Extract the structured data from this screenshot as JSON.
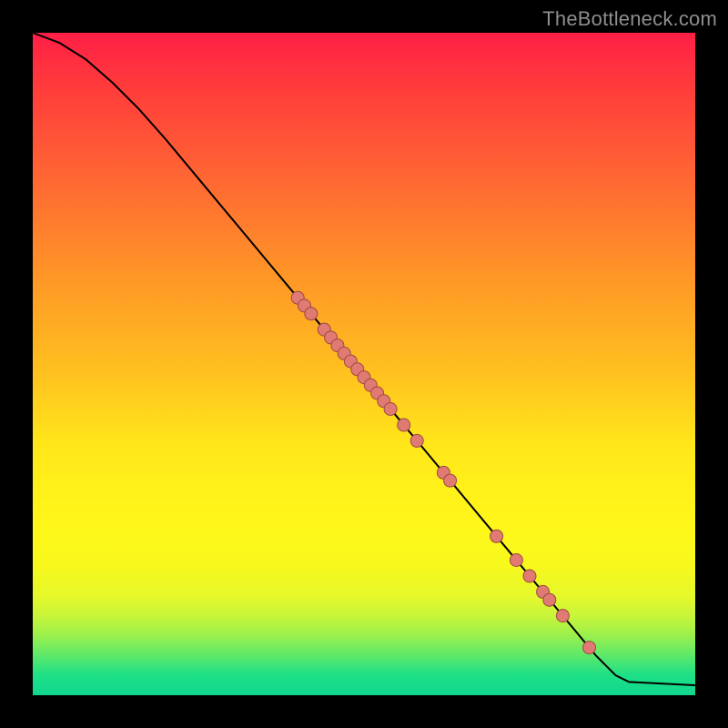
{
  "watermark": "TheBottleneck.com",
  "chart_data": {
    "type": "line",
    "title": "",
    "xlabel": "",
    "ylabel": "",
    "xlim": [
      0,
      100
    ],
    "ylim": [
      0,
      100
    ],
    "grid": false,
    "curve": [
      {
        "x": 0,
        "y": 100
      },
      {
        "x": 4,
        "y": 98.5
      },
      {
        "x": 8,
        "y": 96
      },
      {
        "x": 12,
        "y": 92.5
      },
      {
        "x": 16,
        "y": 88.5
      },
      {
        "x": 20,
        "y": 84
      },
      {
        "x": 25,
        "y": 78
      },
      {
        "x": 30,
        "y": 72
      },
      {
        "x": 35,
        "y": 66
      },
      {
        "x": 40,
        "y": 60
      },
      {
        "x": 45,
        "y": 54
      },
      {
        "x": 50,
        "y": 48
      },
      {
        "x": 55,
        "y": 42
      },
      {
        "x": 60,
        "y": 36
      },
      {
        "x": 65,
        "y": 30
      },
      {
        "x": 70,
        "y": 24
      },
      {
        "x": 75,
        "y": 18
      },
      {
        "x": 80,
        "y": 12
      },
      {
        "x": 85,
        "y": 6
      },
      {
        "x": 88,
        "y": 3
      },
      {
        "x": 90,
        "y": 2
      },
      {
        "x": 100,
        "y": 1.5
      }
    ],
    "points": [
      {
        "x": 40,
        "y": 60
      },
      {
        "x": 41,
        "y": 58.8
      },
      {
        "x": 42,
        "y": 57.6
      },
      {
        "x": 44,
        "y": 55.2
      },
      {
        "x": 45,
        "y": 54
      },
      {
        "x": 46,
        "y": 52.8
      },
      {
        "x": 47,
        "y": 51.6
      },
      {
        "x": 48,
        "y": 50.4
      },
      {
        "x": 49,
        "y": 49.2
      },
      {
        "x": 50,
        "y": 48
      },
      {
        "x": 51,
        "y": 46.8
      },
      {
        "x": 52,
        "y": 45.6
      },
      {
        "x": 53,
        "y": 44.4
      },
      {
        "x": 54,
        "y": 43.2
      },
      {
        "x": 56,
        "y": 40.8
      },
      {
        "x": 58,
        "y": 38.4
      },
      {
        "x": 62,
        "y": 33.6
      },
      {
        "x": 63,
        "y": 32.4
      },
      {
        "x": 70,
        "y": 24
      },
      {
        "x": 73,
        "y": 20.4
      },
      {
        "x": 75,
        "y": 18
      },
      {
        "x": 77,
        "y": 15.6
      },
      {
        "x": 78,
        "y": 14.4
      },
      {
        "x": 80,
        "y": 12
      },
      {
        "x": 84,
        "y": 7.2
      }
    ],
    "point_radius": 7
  }
}
